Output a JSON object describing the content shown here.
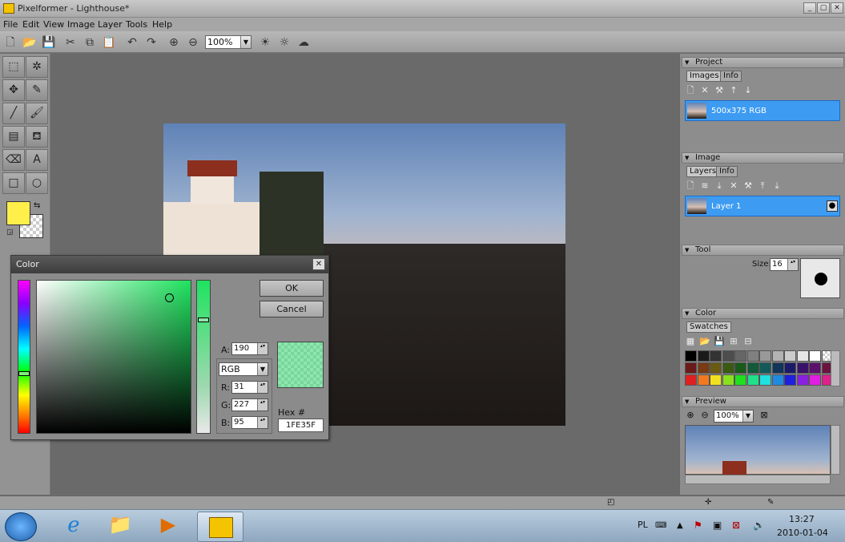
{
  "window": {
    "title": "Pixelformer - Lighthouse*",
    "min": "_",
    "max": "▢",
    "close": "✕"
  },
  "menu": [
    "File",
    "Edit",
    "View",
    "Image",
    "Layer",
    "Tools",
    "Help"
  ],
  "toolbar": {
    "zoom": "100%"
  },
  "panels": {
    "project": {
      "title": "Project",
      "tabs": [
        "Images",
        "Info"
      ],
      "item": "500x375 RGB"
    },
    "image": {
      "title": "Image",
      "tabs": [
        "Layers",
        "Info"
      ],
      "layer": "Layer 1"
    },
    "tool": {
      "title": "Tool",
      "size_label": "Size:",
      "size": "16"
    },
    "color": {
      "title": "Color",
      "tab": "Swatches"
    },
    "preview": {
      "title": "Preview",
      "zoom": "100%"
    }
  },
  "dialog": {
    "title": "Color",
    "ok": "OK",
    "cancel": "Cancel",
    "mode": "RGB",
    "a_label": "A:",
    "a": "190",
    "r_label": "R:",
    "r": "31",
    "g_label": "G:",
    "g": "227",
    "b_label": "B:",
    "b": "95",
    "hex_label": "Hex #",
    "hex": "1FE35F",
    "color": "#1fe35f"
  },
  "taskbar": {
    "lang": "PL",
    "time": "13:27",
    "date": "2010-01-04"
  },
  "colors": {
    "primary": "#ffef4a",
    "accent": "#3d9bf2"
  }
}
